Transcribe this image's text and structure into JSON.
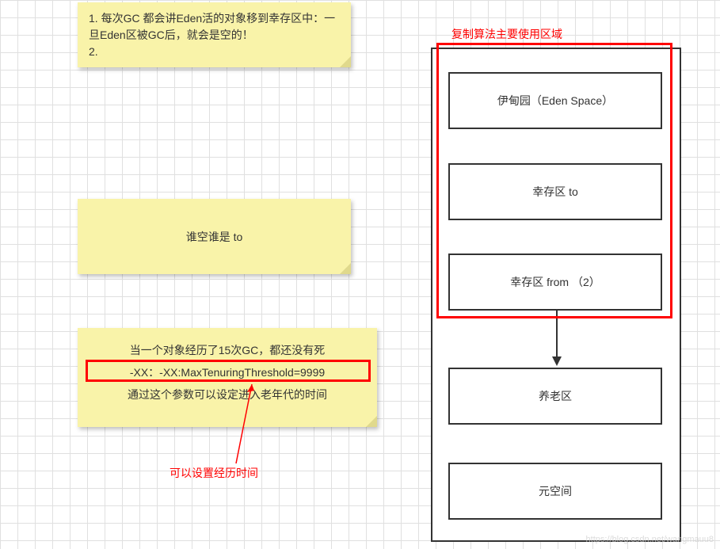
{
  "notes": {
    "top": {
      "line1": "1. 每次GC 都会讲Eden活的对象移到幸存区中：一旦Eden区被GC后，就会是空的！",
      "line2": "2."
    },
    "middle": "谁空谁是 to",
    "bottom": {
      "line1": "当一个对象经历了15次GC，都还没有死",
      "line2": "-XX：-XX:MaxTenuringThreshold=9999",
      "line3": "通过这个参数可以设定进入老年代的时间"
    }
  },
  "annotations": {
    "top_label": "复制算法主要使用区域",
    "bottom_label": "可以设置经历时间"
  },
  "memory_regions": {
    "eden": "伊甸园（Eden Space）",
    "survivor_to": "幸存区  to",
    "survivor_from": "幸存区  from （2）",
    "old_gen": "养老区",
    "metaspace": "元空间"
  },
  "watermark": "https://blog.csdn.net/wangmauu8"
}
